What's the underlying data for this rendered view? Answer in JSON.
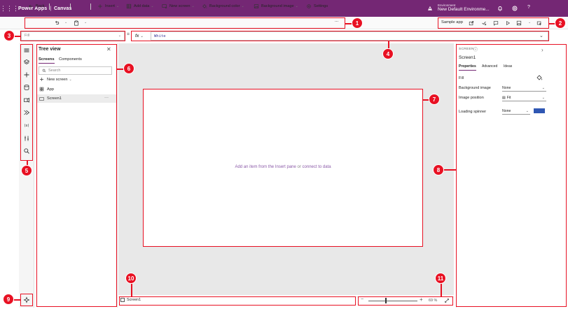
{
  "titlebar": {
    "app_name": "Power Apps",
    "separator": "|",
    "context": "Canvas",
    "environment_label": "Environment",
    "environment_name": "New Default Environme...",
    "help": "?"
  },
  "commands": {
    "back": "Back",
    "insert": "Insert",
    "add_data": "Add data",
    "new_screen": "New screen",
    "background_color": "Background color",
    "background_image": "Background image",
    "settings": "Settings",
    "more": "...",
    "app_name": "Sample app"
  },
  "formula_bar": {
    "property": "Fill",
    "equals": "=",
    "fx": "fx",
    "formula": "White"
  },
  "tree_view": {
    "title": "Tree view",
    "tabs": [
      "Screens",
      "Components"
    ],
    "search_placeholder": "Search",
    "new_screen": "New screen",
    "items": [
      "App",
      "Screen1"
    ],
    "more": "···"
  },
  "canvas": {
    "hint_link1": "Add an item from the Insert pane",
    "hint_or": " or ",
    "hint_link2": "connect to data"
  },
  "properties": {
    "type_label": "SCREEN",
    "name": "Screen1",
    "tabs": [
      "Properties",
      "Advanced",
      "Ideas"
    ],
    "rows": [
      {
        "label": "Fill",
        "value": ""
      },
      {
        "label": "Background image",
        "value": "None"
      },
      {
        "label": "Image position",
        "value": "Fit"
      },
      {
        "label": "Loading spinner",
        "value": "None"
      }
    ],
    "fill_color": "#2f57b3"
  },
  "statusbar": {
    "screen": "Screen1",
    "minus": "−",
    "plus": "+",
    "zoom": "69 %"
  },
  "annotations": {
    "color": "#e81123",
    "labels": [
      "1",
      "2",
      "3",
      "4",
      "5",
      "6",
      "7",
      "8",
      "9",
      "10",
      "11"
    ]
  }
}
